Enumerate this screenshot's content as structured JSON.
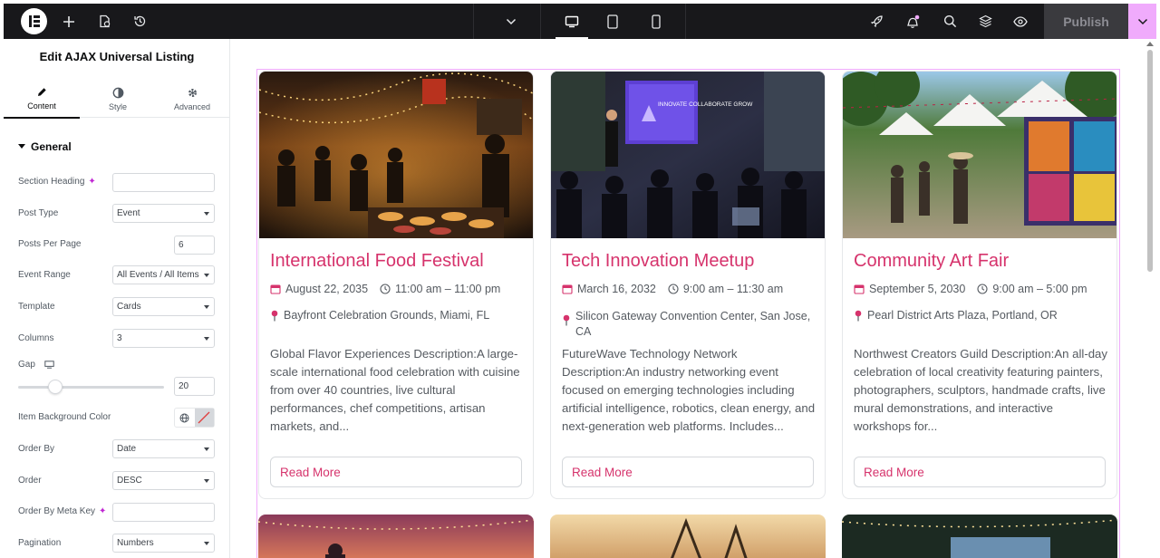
{
  "topbar": {
    "device_dropdown_icon": "chevron-down-icon",
    "publish_label": "Publish",
    "colors": {
      "bar": "#18181b",
      "accent": "#f0abfc"
    }
  },
  "panel": {
    "title": "Edit AJAX Universal Listing",
    "tabs": [
      {
        "label": "Content",
        "icon": "pencil-icon"
      },
      {
        "label": "Style",
        "icon": "contrast-icon"
      },
      {
        "label": "Advanced",
        "icon": "gear-icon"
      }
    ],
    "section": "General",
    "fields": {
      "section_heading": {
        "label": "Section Heading",
        "value": ""
      },
      "post_type": {
        "label": "Post Type",
        "value": "Event"
      },
      "posts_per_page": {
        "label": "Posts Per Page",
        "value": "6"
      },
      "event_range": {
        "label": "Event Range",
        "value": "All Events / All Items"
      },
      "template": {
        "label": "Template",
        "value": "Cards"
      },
      "columns": {
        "label": "Columns",
        "value": "3"
      },
      "gap": {
        "label": "Gap",
        "value": "20"
      },
      "item_bg": {
        "label": "Item Background Color"
      },
      "order_by": {
        "label": "Order By",
        "value": "Date"
      },
      "order": {
        "label": "Order",
        "value": "DESC"
      },
      "order_by_meta": {
        "label": "Order By Meta Key",
        "value": ""
      },
      "pagination": {
        "label": "Pagination",
        "value": "Numbers"
      }
    }
  },
  "cards": [
    {
      "title": "International Food Festival",
      "date": "August 22, 2035",
      "time": "11:00 am – 11:00 pm",
      "location": "Bayfront Celebration Grounds, Miami, FL",
      "description": "Global Flavor Experiences Description:A large-scale international food celebration with cuisine from over 40 countries, live cultural performances, chef competitions, artisan markets, and...",
      "button": "Read More"
    },
    {
      "title": "Tech Innovation Meetup",
      "date": "March 16, 2032",
      "time": "9:00 am – 11:30 am",
      "location": "Silicon Gateway Convention Center, San Jose, CA",
      "description": "FutureWave Technology Network Description:An industry networking event focused on emerging technologies including artificial intelligence, robotics, clean energy, and next-generation web platforms. Includes...",
      "button": "Read More",
      "screen_text": "INNOVATE COLLABORATE GROW"
    },
    {
      "title": "Community Art Fair",
      "date": "September 5, 2030",
      "time": "9:00 am – 5:00 pm",
      "location": "Pearl District Arts Plaza, Portland, OR",
      "description": "Northwest Creators Guild Description:An all-day celebration of local creativity featuring painters, photographers, sculptors, handmade crafts, live mural demonstrations, and interactive workshops for...",
      "button": "Read More"
    }
  ],
  "colors": {
    "title": "#d6336c",
    "muted": "#555a60"
  }
}
